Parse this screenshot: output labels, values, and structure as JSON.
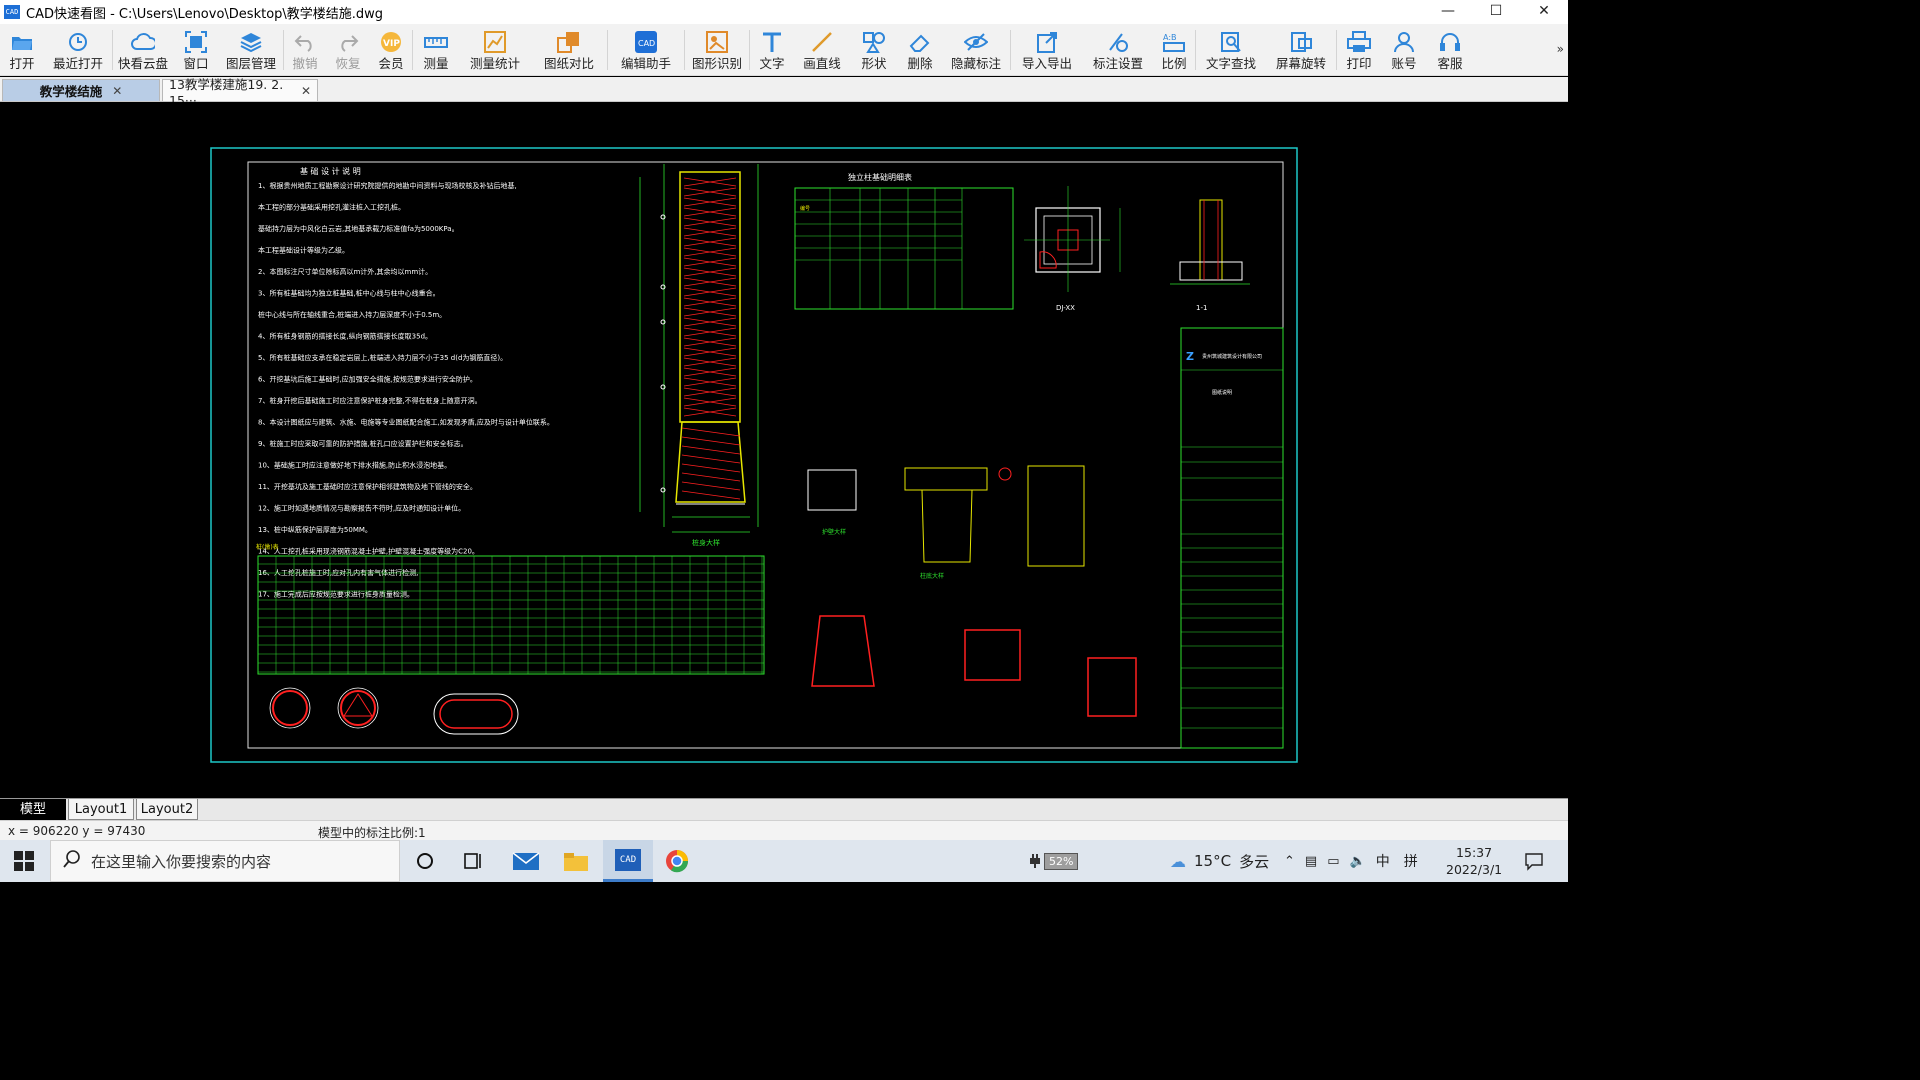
{
  "window": {
    "title": "CAD快速看图 - C:\\Users\\Lenovo\\Desktop\\教学楼结施.dwg",
    "app_icon": "CAD",
    "controls": [
      "minimize-icon",
      "maximize-icon",
      "close-icon"
    ]
  },
  "toolbar": {
    "items": [
      {
        "label": "打开",
        "icon": "open-folder-icon",
        "enabled": true
      },
      {
        "label": "最近打开",
        "icon": "recent-clock-icon",
        "enabled": true
      },
      {
        "label": "快看云盘",
        "icon": "cloud-icon",
        "enabled": true
      },
      {
        "label": "窗口",
        "icon": "window-fit-icon",
        "enabled": true
      },
      {
        "label": "图层管理",
        "icon": "layers-icon",
        "enabled": true
      },
      {
        "label": "撤销",
        "icon": "undo-icon",
        "enabled": false
      },
      {
        "label": "恢复",
        "icon": "redo-icon",
        "enabled": false
      },
      {
        "label": "会员",
        "icon": "vip-icon",
        "enabled": true
      },
      {
        "label": "测量",
        "icon": "ruler-icon",
        "enabled": true
      },
      {
        "label": "测量统计",
        "icon": "measure-stats-icon",
        "enabled": true
      },
      {
        "label": "图纸对比",
        "icon": "compare-icon",
        "enabled": true
      },
      {
        "label": "编辑助手",
        "icon": "edit-assistant-icon",
        "enabled": true
      },
      {
        "label": "图形识别",
        "icon": "shape-recognize-icon",
        "enabled": true
      },
      {
        "label": "文字",
        "icon": "text-icon",
        "enabled": true
      },
      {
        "label": "画直线",
        "icon": "line-icon",
        "enabled": true
      },
      {
        "label": "形状",
        "icon": "shape-icon",
        "enabled": true
      },
      {
        "label": "删除",
        "icon": "eraser-icon",
        "enabled": true
      },
      {
        "label": "隐藏标注",
        "icon": "hide-eye-icon",
        "enabled": true
      },
      {
        "label": "导入导出",
        "icon": "import-export-icon",
        "enabled": true
      },
      {
        "label": "标注设置",
        "icon": "annotation-settings-icon",
        "enabled": true
      },
      {
        "label": "比例",
        "icon": "scale-icon",
        "enabled": true
      },
      {
        "label": "文字查找",
        "icon": "text-search-icon",
        "enabled": true
      },
      {
        "label": "屏幕旋转",
        "icon": "rotate-screen-icon",
        "enabled": true
      },
      {
        "label": "打印",
        "icon": "printer-icon",
        "enabled": true
      },
      {
        "label": "账号",
        "icon": "user-icon",
        "enabled": true
      },
      {
        "label": "客服",
        "icon": "headset-icon",
        "enabled": true
      }
    ],
    "more": "»"
  },
  "doc_tabs": [
    {
      "label": "教学楼结施",
      "active": true,
      "close": "✕"
    },
    {
      "label": "13教学楼建施19. 2. 15···",
      "active": false,
      "close": "✕"
    }
  ],
  "drawing": {
    "notes_title": "基 础 设 计 说 明",
    "notes": [
      "1、根据贵州地质工程勘察设计研究院提供的地勘中间资料与现场校核及补钻后地基,",
      "   本工程的部分基础采用挖孔灌注桩入工挖孔桩。",
      "   基础持力层为中风化白云岩,其地基承载力标准值fa为5000KPa。",
      "   本工程基础设计等级为乙级。",
      "2、本图标注尺寸单位除标高以m计外,其余均以mm计。",
      "3、所有桩基础均为独立桩基础,桩中心线与柱中心线重合。",
      "   桩中心线与所在轴线重合,桩端进入持力层深度不小于0.5m。",
      "4、所有桩身钢筋的搭接长度,纵向钢筋搭接长度取35d。",
      "5、所有桩基础应支承在稳定岩层上,桩端进入持力层不小于35 d(d为钢筋直径)。",
      "6、开挖基坑后施工基础时,应加强安全措施,按规范要求进行安全防护。",
      "7、桩身开挖后基础施工时应注意保护桩身完整,不得在桩身上随意开洞。",
      "8、本设计图纸应与建筑、水施、电施等专业图纸配合施工,如发现矛盾,应及时与设计单位联系。",
      "9、桩施工时应采取可靠的防护措施,桩孔口应设置护栏和安全标志。",
      "10、基础施工时应注意做好地下排水措施,防止积水浸泡地基。",
      "11、开挖基坑及施工基础时应注意保护相邻建筑物及地下管线的安全。",
      "12、施工时如遇地质情况与勘察报告不符时,应及时通知设计单位。",
      "13、桩中纵筋保护层厚度为50MM。",
      "14、人工挖孔桩采用现浇钢筋混凝土护壁,护壁混凝土强度等级为C20。",
      "16、人工挖孔桩施工时,应对孔内有害气体进行检测,",
      "17、施工完成后应按规范要求进行桩身质量检测。"
    ],
    "pile_table_title": "独立柱基础明细表",
    "pile_table_header": "编号",
    "title_block": {
      "company": "贵州筑城建筑设计有限公司",
      "design_notes_title": "图纸说明"
    },
    "detail_labels": {
      "dj": "DJ-XX",
      "section": "1-1",
      "pile_detail": "桩身大样",
      "cap_detail": "护壁大样",
      "col_detail": "柱底大样",
      "table_label": "桩(墩)表"
    }
  },
  "layout_tabs": [
    {
      "label": "模型",
      "active": true
    },
    {
      "label": "Layout1",
      "active": false
    },
    {
      "label": "Layout2",
      "active": false
    }
  ],
  "status": {
    "coords": "x = 906220  y = 97430",
    "scale_text": "模型中的标注比例:1"
  },
  "taskbar": {
    "search_placeholder": "在这里输入你要搜索的内容",
    "battery": "52%",
    "weather_temp": "15°C",
    "weather_text": "多云",
    "ime": "中",
    "ime2": "拼",
    "time": "15:37",
    "date": "2022/3/1"
  },
  "colors": {
    "canvas_bg": "#000000",
    "frame_cyan": "#1ec8c8",
    "cad_green": "#2ee22e",
    "cad_yellow": "#e6e600",
    "cad_red": "#ff2020",
    "cad_white": "#ffffff",
    "active_tab": "#b9cde6"
  }
}
